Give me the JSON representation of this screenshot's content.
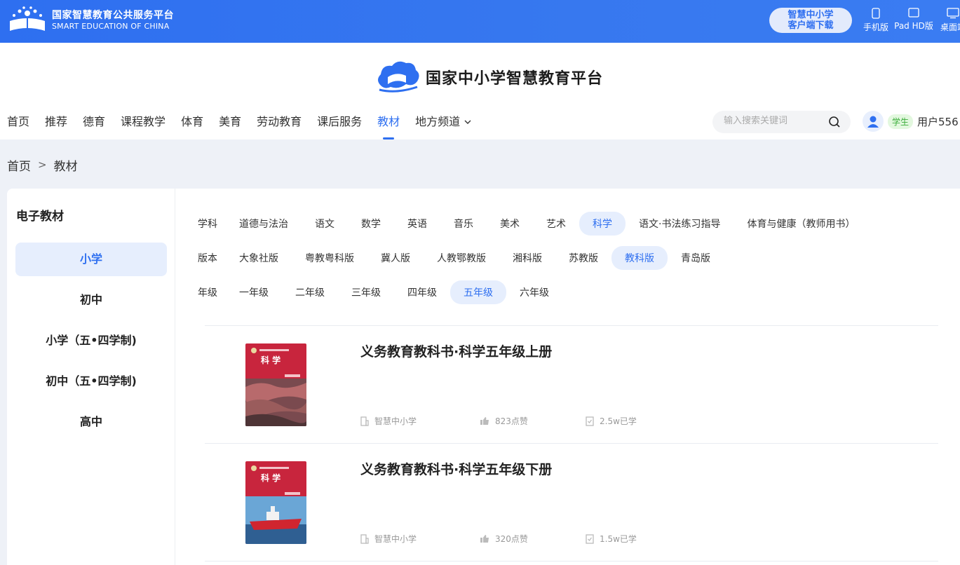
{
  "topbar": {
    "logo_cn": "国家智慧教育公共服务平台",
    "logo_en": "SMART EDUCATION OF CHINA",
    "download_line1": "智慧中小学",
    "download_line2": "客户端下载",
    "devices": [
      {
        "label": "手机版",
        "icon": "phone-icon"
      },
      {
        "label": "Pad HD版",
        "icon": "tablet-icon"
      },
      {
        "label": "桌面端",
        "icon": "desktop-icon"
      }
    ]
  },
  "header": {
    "brand_title": "国家中小学智慧教育平台",
    "nav": [
      "首页",
      "推荐",
      "德育",
      "课程教学",
      "体育",
      "美育",
      "劳动教育",
      "课后服务",
      "教材",
      "地方频道"
    ],
    "active_nav": "教材",
    "search_placeholder": "输入搜索关键词",
    "user_role": "学生",
    "user_name": "用户556"
  },
  "breadcrumb": {
    "home": "首页",
    "sep": ">",
    "current": "教材"
  },
  "sidebar": {
    "title": "电子教材",
    "items": [
      "小学",
      "初中",
      "小学（五•四学制)",
      "初中（五•四学制)",
      "高中"
    ],
    "active": "小学"
  },
  "filters": {
    "subject": {
      "label": "学科",
      "options": [
        "道德与法治",
        "语文",
        "数学",
        "英语",
        "音乐",
        "美术",
        "艺术",
        "科学",
        "语文·书法练习指导",
        "体育与健康（教师用书）"
      ],
      "active": "科学"
    },
    "edition": {
      "label": "版本",
      "options": [
        "大象社版",
        "粤教粤科版",
        "冀人版",
        "人教鄂教版",
        "湘科版",
        "苏教版",
        "教科版",
        "青岛版"
      ],
      "active": "教科版"
    },
    "grade": {
      "label": "年级",
      "options": [
        "一年级",
        "二年级",
        "三年级",
        "四年级",
        "五年级",
        "六年级"
      ],
      "active": "五年级"
    }
  },
  "books": [
    {
      "title": "义务教育教科书·科学五年级上册",
      "publisher": "智慧中小学",
      "likes": "823点赞",
      "learned": "2.5w已学",
      "cover_word": "科 学"
    },
    {
      "title": "义务教育教科书·科学五年级下册",
      "publisher": "智慧中小学",
      "likes": "320点赞",
      "learned": "1.5w已学",
      "cover_word": "科 学"
    }
  ],
  "colors": {
    "primary": "#2e6ff0",
    "active_bg": "#e6eefd",
    "cover_red": "#c8253d"
  }
}
